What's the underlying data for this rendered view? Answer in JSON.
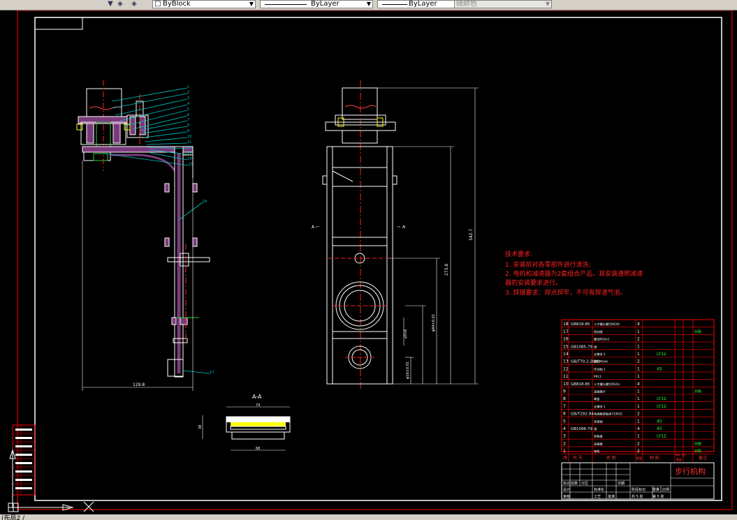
{
  "toolbar": {
    "linetype_block": "ByBlock",
    "linetype_layer": "ByLayer",
    "lineweight_layer": "ByLayer",
    "plotstyle": "随颜色"
  },
  "drawing": {
    "section_label": "A-A",
    "dim_width_side": "129.8",
    "dim_section_top": "74",
    "dim_section_bottom": "68",
    "dim_section_height": "38",
    "dim_total_height": "342.7",
    "dim_mid_height": "273.8",
    "dim_bore": "φ84±0.01",
    "dim_bottom_bore": "φ16±0.01",
    "dim_small": "φ55H6",
    "view_arrow_left": "A",
    "view_arrow_right": "A",
    "part_callouts": [
      "1",
      "2",
      "3",
      "4",
      "5",
      "6",
      "7",
      "8",
      "9",
      "10",
      "11",
      "12",
      "13",
      "14",
      "15",
      "16",
      "17"
    ]
  },
  "notes": {
    "title": "技术要求:",
    "lines": [
      "1. 安装前对各零部件进行清洗;",
      "2. 电机和减速器为2套组合产品，其安装遵照减速",
      "器的安装要求进行。",
      "3. 焊接要求：焊点焊牢，不可有焊渣气泡。"
    ]
  },
  "bom": {
    "rows": [
      {
        "no": "18",
        "code": "GB818-85",
        "name": "十字槽头螺钉M2X6",
        "qty": "4",
        "mat": "",
        "note": ""
      },
      {
        "no": "17",
        "code": "",
        "name": "密封圈",
        "qty": "1",
        "mat": "",
        "note": "外购"
      },
      {
        "no": "16",
        "code": "",
        "name": "螺母M10x1",
        "qty": "2",
        "mat": "",
        "note": ""
      },
      {
        "no": "15",
        "code": "GB1085-79",
        "name": "键",
        "qty": "1",
        "mat": "",
        "note": ""
      },
      {
        "no": "14",
        "code": "",
        "name": "支撑块 2",
        "qty": "1",
        "mat": "LY12",
        "note": ""
      },
      {
        "no": "13",
        "code": "GB/T70.2-2000",
        "name": "螺钉M3x6",
        "qty": "2",
        "mat": "",
        "note": ""
      },
      {
        "no": "12",
        "code": "",
        "name": "传动轴 1",
        "qty": "1",
        "mat": "45",
        "note": ""
      },
      {
        "no": "11",
        "code": "",
        "name": "PR12",
        "qty": "1",
        "mat": "",
        "note": ""
      },
      {
        "no": "10",
        "code": "GB818-85",
        "name": "十字槽头螺钉M2X3",
        "qty": "4",
        "mat": "",
        "note": ""
      },
      {
        "no": "9",
        "code": "",
        "name": "减速器计",
        "qty": "1",
        "mat": "",
        "note": "外购"
      },
      {
        "no": "8",
        "code": "",
        "name": "端盖",
        "qty": "1",
        "mat": "LY12",
        "note": ""
      },
      {
        "no": "7",
        "code": "",
        "name": "支撑块 1",
        "qty": "1",
        "mat": "LY12",
        "note": ""
      },
      {
        "no": "6",
        "code": "GB/T292-94",
        "name": "角接触球轴承71903C",
        "qty": "2",
        "mat": "",
        "note": ""
      },
      {
        "no": "5",
        "code": "",
        "name": "连接轴",
        "qty": "1",
        "mat": "45",
        "note": ""
      },
      {
        "no": "4",
        "code": "GB1096-79",
        "name": "键",
        "qty": "4",
        "mat": "45",
        "note": ""
      },
      {
        "no": "3",
        "code": "",
        "name": "轮毂盘",
        "qty": "1",
        "mat": "LY12",
        "note": ""
      },
      {
        "no": "2",
        "code": "",
        "name": "减速器",
        "qty": "2",
        "mat": "",
        "note": "外购"
      },
      {
        "no": "1",
        "code": "",
        "name": "电机",
        "qty": "2",
        "mat": "",
        "note": "外购"
      }
    ],
    "header": {
      "no": "序",
      "code": "代  号",
      "name": "名  称",
      "qty": "数量",
      "mat": "材  料",
      "unit": "单件 总计",
      "weight": "重量",
      "note": "备注"
    }
  },
  "titleblock": {
    "title": "步行机构",
    "stage": "阶段标记",
    "weight": "重量",
    "scale": "比例",
    "sheet_total": "共 5 张",
    "sheet_no": "第 5 张",
    "design": "设计",
    "standard": "标准化",
    "check": "审核",
    "process": "工艺",
    "approve": "批准",
    "marks": "标记",
    "count": "处数",
    "zone": "分区",
    "date": "日期"
  },
  "statusbar": {
    "text": "(布局2 /"
  }
}
